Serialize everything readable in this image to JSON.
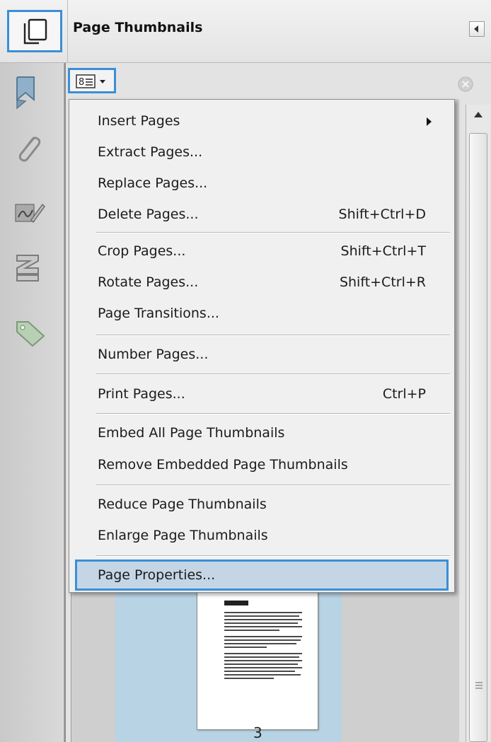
{
  "header": {
    "title": "Page Thumbnails"
  },
  "rail": {
    "icons": [
      "bookmark-icon",
      "attachment-icon",
      "signature-icon",
      "layers-icon",
      "tag-icon"
    ]
  },
  "menu": {
    "items": [
      {
        "label": "Insert Pages",
        "shortcut": "",
        "submenu": true
      },
      {
        "label": "Extract Pages...",
        "shortcut": ""
      },
      {
        "label": "Replace Pages...",
        "shortcut": ""
      },
      {
        "label": "Delete Pages...",
        "shortcut": "Shift+Ctrl+D"
      },
      {
        "label": "Crop Pages...",
        "shortcut": "Shift+Ctrl+T"
      },
      {
        "label": "Rotate Pages...",
        "shortcut": "Shift+Ctrl+R"
      },
      {
        "label": "Page Transitions...",
        "shortcut": ""
      },
      {
        "label": "Number Pages...",
        "shortcut": ""
      },
      {
        "label": "Print Pages...",
        "shortcut": "Ctrl+P"
      },
      {
        "label": "Embed All Page Thumbnails",
        "shortcut": ""
      },
      {
        "label": "Remove Embedded Page Thumbnails",
        "shortcut": ""
      },
      {
        "label": "Reduce Page Thumbnails",
        "shortcut": ""
      },
      {
        "label": "Enlarge Page Thumbnails",
        "shortcut": ""
      },
      {
        "label": "Page Properties...",
        "shortcut": "",
        "selected": true
      }
    ]
  },
  "thumbnail": {
    "page_number": "3"
  },
  "colors": {
    "accent": "#3a8fd6",
    "selection": "#c4d6e6",
    "thumb_highlight": "#b7d3e4"
  }
}
